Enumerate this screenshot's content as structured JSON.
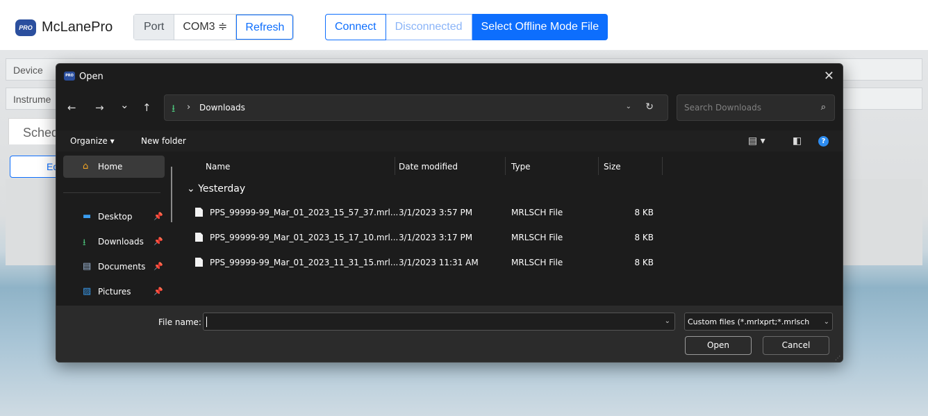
{
  "app": {
    "logo_text": "PRO",
    "name": "McLanePro",
    "port_label": "Port",
    "port_value": "COM3 ≑",
    "refresh_label": "Refresh",
    "connect_label": "Connect",
    "disconnected_label": "Disconnected",
    "offline_label": "Select Offline Mode File",
    "row1_label": "Device",
    "row2_label": "Instrume",
    "schedule_tab": "Schedu",
    "ed_label": "Ed",
    "accent": "#0d6efd"
  },
  "dialog": {
    "title": "Open",
    "close": "✕",
    "nav": {
      "back": "←",
      "forward": "→",
      "recent": "⌄",
      "up": "↑"
    },
    "breadcrumb_sep": "›",
    "breadcrumb": "Downloads",
    "address_dropdown": "⌄",
    "refresh_icon": "↻",
    "search_placeholder": "Search Downloads",
    "organize_label": "Organize ▾",
    "new_folder_label": "New folder",
    "sidebar": [
      {
        "label": "Home",
        "icon": "home-icon",
        "pinned": false
      },
      {
        "label": "Desktop",
        "icon": "desktop-icon",
        "pinned": true
      },
      {
        "label": "Downloads",
        "icon": "downloads-icon",
        "pinned": true
      },
      {
        "label": "Documents",
        "icon": "documents-icon",
        "pinned": true
      },
      {
        "label": "Pictures",
        "icon": "pictures-icon",
        "pinned": true
      }
    ],
    "columns": {
      "name": "Name",
      "date": "Date modified",
      "type": "Type",
      "size": "Size"
    },
    "group_label": "Yesterday",
    "files": [
      {
        "name": "PPS_99999-99_Mar_01_2023_15_57_37.mrl...",
        "date": "3/1/2023 3:57 PM",
        "type": "MRLSCH File",
        "size": "8 KB"
      },
      {
        "name": "PPS_99999-99_Mar_01_2023_15_17_10.mrl...",
        "date": "3/1/2023 3:17 PM",
        "type": "MRLSCH File",
        "size": "8 KB"
      },
      {
        "name": "PPS_99999-99_Mar_01_2023_11_31_15.mrl...",
        "date": "3/1/2023 11:31 AM",
        "type": "MRLSCH File",
        "size": "8 KB"
      }
    ],
    "file_name_label": "File name:",
    "file_name_value": "",
    "filter_value": "Custom files (*.mrlxprt;*.mrlsch",
    "open_label": "Open",
    "cancel_label": "Cancel"
  }
}
